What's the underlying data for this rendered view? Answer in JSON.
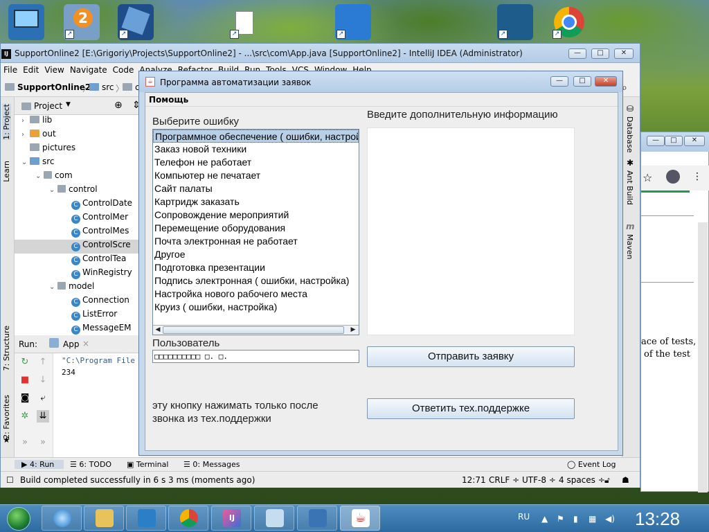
{
  "ide": {
    "title": "SupportOnline2 [E:\\Grigoriy\\Projects\\SupportOnline2] - ...\\src\\com\\App.java [SupportOnline2] - IntelliJ IDEA (Administrator)",
    "menu": [
      "File",
      "Edit",
      "View",
      "Navigate",
      "Code",
      "Analyze",
      "Refactor",
      "Build",
      "Run",
      "Tools",
      "VCS",
      "Window",
      "Help"
    ],
    "breadcrumbs": [
      "SupportOnline2",
      "src",
      "co"
    ],
    "left_tabs": [
      "1: Project",
      "Learn",
      "7: Structure",
      "2: Favorites"
    ],
    "right_tabs": [
      "Database",
      "Ant Build",
      "Maven"
    ],
    "project_panel_title": "Project",
    "tree": [
      {
        "label": "lib",
        "kind": "folder",
        "depth": 1,
        "arrow": "›"
      },
      {
        "label": "out",
        "kind": "folder-orange",
        "depth": 1,
        "arrow": "›"
      },
      {
        "label": "pictures",
        "kind": "folder",
        "depth": 1,
        "arrow": ""
      },
      {
        "label": "src",
        "kind": "folder-blue",
        "depth": 1,
        "arrow": "⌄"
      },
      {
        "label": "com",
        "kind": "package",
        "depth": 2,
        "arrow": "⌄"
      },
      {
        "label": "control",
        "kind": "package",
        "depth": 3,
        "arrow": "⌄"
      },
      {
        "label": "ControlDate",
        "kind": "class",
        "depth": 4,
        "arrow": ""
      },
      {
        "label": "ControlMer",
        "kind": "class",
        "depth": 4,
        "arrow": ""
      },
      {
        "label": "ControlMes",
        "kind": "class",
        "depth": 4,
        "arrow": ""
      },
      {
        "label": "ControlScre",
        "kind": "class",
        "depth": 4,
        "arrow": "",
        "selected": true
      },
      {
        "label": "ControlTea",
        "kind": "class",
        "depth": 4,
        "arrow": ""
      },
      {
        "label": "WinRegistry",
        "kind": "class",
        "depth": 4,
        "arrow": ""
      },
      {
        "label": "model",
        "kind": "package",
        "depth": 3,
        "arrow": "⌄"
      },
      {
        "label": "Connection",
        "kind": "class",
        "depth": 4,
        "arrow": ""
      },
      {
        "label": "ListError",
        "kind": "class",
        "depth": 4,
        "arrow": ""
      },
      {
        "label": "MessageEM",
        "kind": "class",
        "depth": 4,
        "arrow": ""
      }
    ],
    "run": {
      "label": "Run:",
      "tab": "App"
    },
    "console_lines": [
      "\"C:\\Program File",
      "234"
    ],
    "bottom_tabs": [
      "4: Run",
      "6: TODO",
      "Terminal",
      "0: Messages",
      "Event Log"
    ],
    "status": {
      "message": "Build completed successfully in 6 s 3 ms (moments ago)",
      "position": "12:71",
      "line_sep": "CRLF ÷",
      "encoding": "UTF-8 ÷",
      "indent": "4 spaces ÷"
    }
  },
  "chrome_bg": {
    "texts": [
      "ace of tests,",
      "of the test"
    ]
  },
  "dialog": {
    "title": "Программа автоматизации заявок",
    "menu": "Помощь",
    "error_label": "Выберите ошибку",
    "errors": [
      "Программное обеспечение ( ошибки, настройка)",
      "Заказ новой техники",
      "Телефон не работает",
      "Компьютер не печатает",
      "Сайт палаты",
      "Картридж заказать",
      "Сопровождение мероприятий",
      "Перемещение оборудования",
      "Почта электронная не работает",
      "Другое",
      "Подготовка презентации",
      "Подпись электронная ( ошибки, настройка)",
      "Настройка нового рабочего места",
      "Круиз ( ошибки, настройка)"
    ],
    "selected_index": 0,
    "info_label": "Введите дополнительную информацию",
    "info_value": "",
    "user_label": "Пользователь",
    "user_value": "□□□□□□□□□□ □. □.",
    "send_button": "Отправить заявку",
    "note_line1": "эту кнопку нажимать только после",
    "note_line2": "звонка из тех.поддержки",
    "reply_button": "Ответить тех.поддержке"
  },
  "taskbar": {
    "language": "RU",
    "clock": "13:28",
    "apps": [
      "internet-explorer",
      "file-explorer",
      "media-player",
      "chrome",
      "intellij-idea",
      "notepad",
      "network",
      "java"
    ],
    "active_app": "java"
  },
  "desktop": {
    "icons": [
      "computer-icon",
      "app-2-icon",
      "virtualbox-icon",
      "java-file-icon",
      "folder-shortcut-icon",
      "mysql-workbench-icon",
      "chrome-icon"
    ],
    "badge": "2"
  },
  "colors": {
    "accent": "#3a86c8",
    "dialog_frame": "#c9d9ec",
    "selection": "#b8cfe5",
    "taskbar": "#2d6a9f"
  }
}
